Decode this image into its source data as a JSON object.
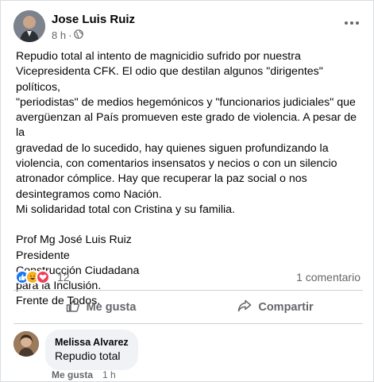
{
  "post": {
    "author": "Jose Luis Ruiz",
    "time": "8 h",
    "separator": "·",
    "audience_icon": "globe-icon",
    "more_icon": "more-options-icon",
    "body_paragraphs": [
      "Repudio total al intento de magnicidio sufrido por nuestra",
      "Vicepresidenta CFK. El odio que destilan algunos \"dirigentes\" políticos,",
      "\"periodistas\" de medios hegemónicos y \"funcionarios judiciales\" que",
      "avergüenzan al País promueven este grado de violencia. A pesar de la",
      "gravedad de lo sucedido, hay quienes siguen profundizando la",
      "violencia, con comentarios insensatos y necios o con un silencio",
      "atronador cómplice. Hay que recuperar la paz social o nos",
      "desintegramos como Nación.",
      "Mi solidaridad total con Cristina y su familia."
    ],
    "signature": [
      "Prof Mg José Luis Ruiz",
      "Presidente",
      "Construcción Ciudadana",
      "para la Inclusión.",
      "Frente de Todos."
    ]
  },
  "stats": {
    "reaction_icons": [
      "like-reaction-icon",
      "haha-reaction-icon",
      "love-reaction-icon"
    ],
    "reaction_count": "12",
    "comment_count": "1 comentario"
  },
  "actions": {
    "like": {
      "label": "Me gusta",
      "icon": "thumbs-up-icon"
    },
    "comment": {
      "label": "Compartir",
      "icon": "share-icon"
    }
  },
  "comment": {
    "author": "Melissa Alvarez",
    "text": "Repudio total",
    "like_label": "Me gusta",
    "time": "1 h"
  },
  "colors": {
    "like_blue": "#1877f2",
    "love_red": "#f33e58",
    "haha_yellow": "#f7b125",
    "secondary_text": "#65676b"
  }
}
